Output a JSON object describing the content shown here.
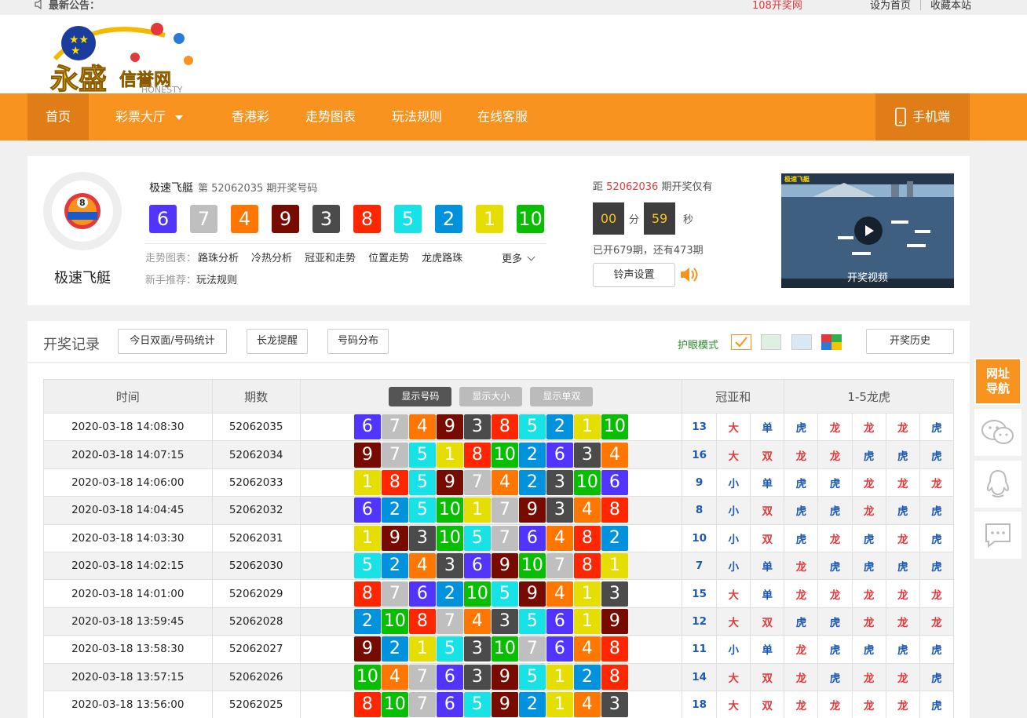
{
  "topbar": {
    "notice_label": "最新公告：",
    "link_108": "108开奖网",
    "set_home": "设为首页",
    "bookmark": "收藏本站"
  },
  "nav": {
    "home": "首页",
    "lottery_hall": "彩票大厅",
    "hk_lottery": "香港彩",
    "trend_chart": "走势图表",
    "rules": "玩法规则",
    "service": "在线客服",
    "mobile": "手机端"
  },
  "game": {
    "name": "极速飞艇",
    "title": "极速飞艇",
    "period_text": "第 52062035 期开奖号码",
    "balls": [
      6,
      7,
      4,
      9,
      3,
      8,
      5,
      2,
      1,
      10
    ],
    "trend_label": "走势图表：",
    "trend_links": [
      "路珠分析",
      "冷热分析",
      "冠亚和走势",
      "位置走势",
      "龙虎路珠"
    ],
    "more": "更多",
    "new_label": "新手推荐：",
    "new_link": "玩法规则"
  },
  "countdown": {
    "prefix": "距",
    "next_period": "52062036",
    "suffix": "期开奖仅有",
    "minutes": "00",
    "min_unit": "分",
    "seconds": "59",
    "sec_unit": "秒",
    "opened_text": "已开679期，还有473期",
    "ring_button": "铃声设置"
  },
  "video": {
    "label": "开奖视频",
    "game_logo": "极速飞艇"
  },
  "records": {
    "title": "开奖记录",
    "btn_today": "今日双面/号码统计",
    "btn_long": "长龙提醒",
    "btn_dist": "号码分布",
    "eye_label": "护眼模式",
    "btn_history": "开奖历史",
    "col_time": "时间",
    "col_issue": "期数",
    "show_number": "显示号码",
    "show_size": "显示大小",
    "show_oddeven": "显示单双",
    "col_sum": "冠亚和",
    "col_dragon": "1-5龙虎",
    "rows": [
      {
        "time": "2020-03-18 14:08:30",
        "issue": "52062035",
        "balls": [
          6,
          7,
          4,
          9,
          3,
          8,
          5,
          2,
          1,
          10
        ],
        "sum": "13",
        "size": "大",
        "oe": "单",
        "dt": [
          "虎",
          "龙",
          "龙",
          "龙",
          "虎"
        ]
      },
      {
        "time": "2020-03-18 14:07:15",
        "issue": "52062034",
        "balls": [
          9,
          7,
          5,
          1,
          8,
          10,
          2,
          6,
          3,
          4
        ],
        "sum": "16",
        "size": "大",
        "oe": "双",
        "dt": [
          "龙",
          "龙",
          "虎",
          "虎",
          "虎"
        ]
      },
      {
        "time": "2020-03-18 14:06:00",
        "issue": "52062033",
        "balls": [
          1,
          8,
          5,
          9,
          7,
          4,
          2,
          3,
          10,
          6
        ],
        "sum": "9",
        "size": "小",
        "oe": "单",
        "dt": [
          "虎",
          "虎",
          "龙",
          "龙",
          "龙"
        ]
      },
      {
        "time": "2020-03-18 14:04:45",
        "issue": "52062032",
        "balls": [
          6,
          2,
          5,
          10,
          1,
          7,
          9,
          3,
          4,
          8
        ],
        "sum": "8",
        "size": "小",
        "oe": "双",
        "dt": [
          "虎",
          "虎",
          "龙",
          "虎",
          "虎"
        ]
      },
      {
        "time": "2020-03-18 14:03:30",
        "issue": "52062031",
        "balls": [
          1,
          9,
          3,
          10,
          5,
          7,
          6,
          4,
          8,
          2
        ],
        "sum": "10",
        "size": "小",
        "oe": "双",
        "dt": [
          "虎",
          "龙",
          "虎",
          "龙",
          "虎"
        ]
      },
      {
        "time": "2020-03-18 14:02:15",
        "issue": "52062030",
        "balls": [
          5,
          2,
          4,
          3,
          6,
          9,
          10,
          7,
          8,
          1
        ],
        "sum": "7",
        "size": "小",
        "oe": "单",
        "dt": [
          "龙",
          "虎",
          "虎",
          "虎",
          "虎"
        ]
      },
      {
        "time": "2020-03-18 14:01:00",
        "issue": "52062029",
        "balls": [
          8,
          7,
          6,
          2,
          10,
          5,
          9,
          4,
          1,
          3
        ],
        "sum": "15",
        "size": "大",
        "oe": "单",
        "dt": [
          "龙",
          "龙",
          "龙",
          "龙",
          "龙"
        ]
      },
      {
        "time": "2020-03-18 13:59:45",
        "issue": "52062028",
        "balls": [
          2,
          10,
          8,
          7,
          4,
          3,
          5,
          6,
          1,
          9
        ],
        "sum": "12",
        "size": "大",
        "oe": "双",
        "dt": [
          "虎",
          "虎",
          "龙",
          "龙",
          "龙"
        ]
      },
      {
        "time": "2020-03-18 13:58:30",
        "issue": "52062027",
        "balls": [
          9,
          2,
          1,
          5,
          3,
          10,
          7,
          6,
          4,
          8
        ],
        "sum": "11",
        "size": "小",
        "oe": "单",
        "dt": [
          "龙",
          "虎",
          "虎",
          "虎",
          "虎"
        ]
      },
      {
        "time": "2020-03-18 13:57:15",
        "issue": "52062026",
        "balls": [
          10,
          4,
          7,
          6,
          3,
          9,
          5,
          1,
          2,
          8
        ],
        "sum": "14",
        "size": "大",
        "oe": "双",
        "dt": [
          "龙",
          "虎",
          "龙",
          "龙",
          "虎"
        ]
      },
      {
        "time": "2020-03-18 13:56:00",
        "issue": "52062025",
        "balls": [
          8,
          10,
          7,
          6,
          5,
          9,
          2,
          1,
          4,
          3
        ],
        "sum": "18",
        "size": "大",
        "oe": "双",
        "dt": [
          "龙",
          "龙",
          "龙",
          "龙",
          "虎"
        ]
      }
    ]
  },
  "side": {
    "nav_line1": "网址",
    "nav_line2": "导航"
  },
  "colors": {
    "primary": "#f7931e",
    "nav_active": "#e07d16",
    "red": "#e4393c",
    "blue": "#1d59b5"
  }
}
